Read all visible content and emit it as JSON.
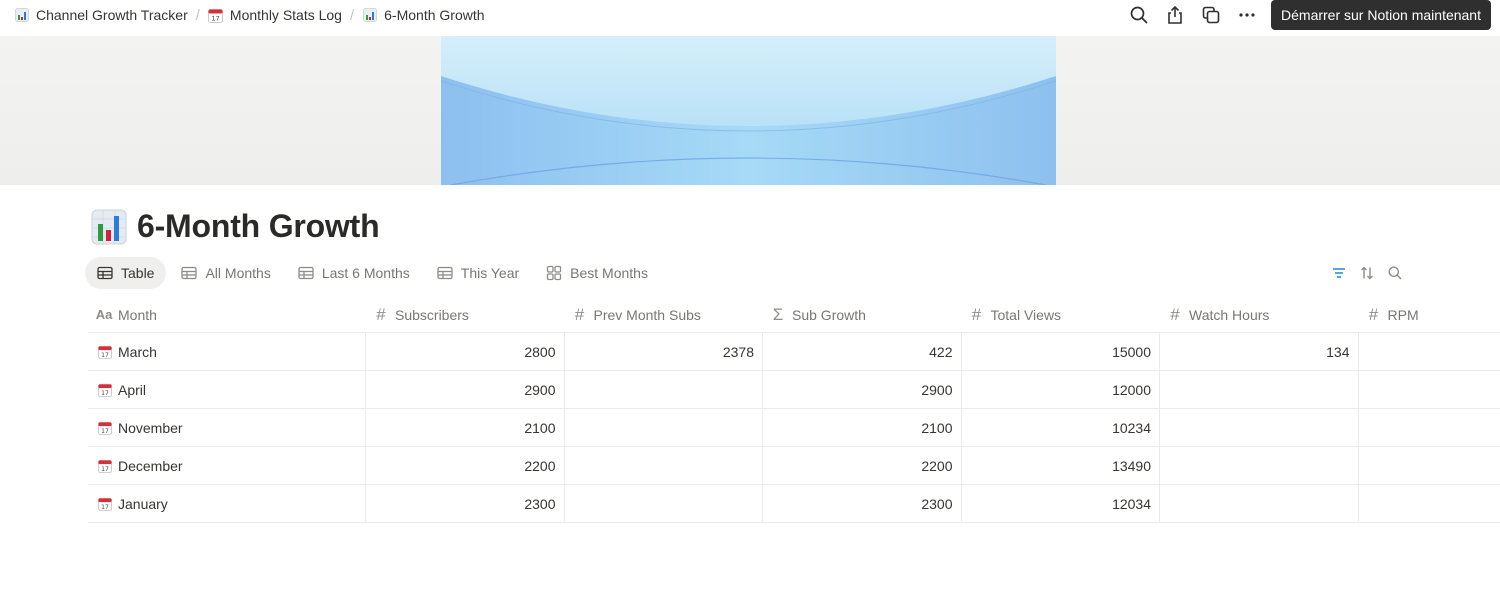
{
  "breadcrumbs": [
    {
      "label": "Channel Growth Tracker",
      "icon": "bar-chart-icon"
    },
    {
      "label": "Monthly Stats Log",
      "icon": "calendar-icon"
    },
    {
      "label": "6-Month Growth",
      "icon": "bar-chart-icon"
    }
  ],
  "top_actions": {
    "cta_label": "Démarrer sur Notion maintenant"
  },
  "page": {
    "title": "6-Month Growth",
    "icon": "bar-chart-icon"
  },
  "views": [
    {
      "label": "Table",
      "icon": "table-icon",
      "active": true
    },
    {
      "label": "All Months",
      "icon": "table-icon",
      "active": false
    },
    {
      "label": "Last 6 Months",
      "icon": "table-icon",
      "active": false
    },
    {
      "label": "This Year",
      "icon": "table-icon",
      "active": false
    },
    {
      "label": "Best Months",
      "icon": "gallery-icon",
      "active": false
    }
  ],
  "table": {
    "columns": [
      {
        "label": "Month",
        "icon": "text-property-icon"
      },
      {
        "label": "Subscribers",
        "icon": "number-property-icon"
      },
      {
        "label": "Prev Month Subs",
        "icon": "number-property-icon"
      },
      {
        "label": "Sub Growth",
        "icon": "formula-property-icon"
      },
      {
        "label": "Total Views",
        "icon": "number-property-icon"
      },
      {
        "label": "Watch Hours",
        "icon": "number-property-icon"
      },
      {
        "label": "RPM",
        "icon": "number-property-icon"
      }
    ],
    "rows": [
      {
        "month": "March",
        "subscribers": "2800",
        "prev_month_subs": "2378",
        "sub_growth": "422",
        "total_views": "15000",
        "watch_hours": "134",
        "rpm": ""
      },
      {
        "month": "April",
        "subscribers": "2900",
        "prev_month_subs": "",
        "sub_growth": "2900",
        "total_views": "12000",
        "watch_hours": "",
        "rpm": ""
      },
      {
        "month": "November",
        "subscribers": "2100",
        "prev_month_subs": "",
        "sub_growth": "2100",
        "total_views": "10234",
        "watch_hours": "",
        "rpm": ""
      },
      {
        "month": "December",
        "subscribers": "2200",
        "prev_month_subs": "",
        "sub_growth": "2200",
        "total_views": "13490",
        "watch_hours": "",
        "rpm": ""
      },
      {
        "month": "January",
        "subscribers": "2300",
        "prev_month_subs": "",
        "sub_growth": "2300",
        "total_views": "12034",
        "watch_hours": "",
        "rpm": ""
      }
    ]
  },
  "colors": {
    "filter_active": "#2383e2",
    "cta_bg": "#2f2f2f",
    "cover_accent": "#9fd3f3"
  }
}
